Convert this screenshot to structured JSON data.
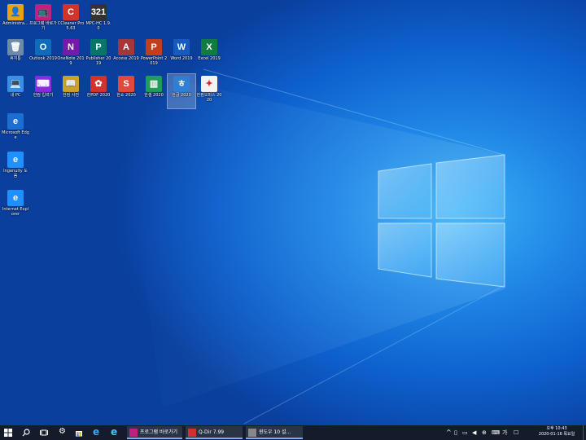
{
  "desktop": {
    "icons": [
      {
        "label": "Administra...",
        "col": 0,
        "row": 0,
        "color": "#e8a21a",
        "glyph": "👤",
        "icon": "user-folder-icon"
      },
      {
        "label": "프로그램 바로가기",
        "col": 1,
        "row": 0,
        "color": "#c2207e",
        "glyph": "📺",
        "icon": "tv-icon"
      },
      {
        "label": "CCleaner Pro 5.63",
        "col": 2,
        "row": 0,
        "color": "#d0352b",
        "glyph": "C",
        "icon": "ccleaner-icon"
      },
      {
        "label": "MPC-HC 1.9.0",
        "col": 3,
        "row": 0,
        "color": "#333333",
        "glyph": "321",
        "icon": "mpc-icon"
      },
      {
        "label": "휴지통",
        "col": 0,
        "row": 1,
        "color": "#6d8aa6",
        "glyph": "🗑",
        "icon": "recycle-bin-icon"
      },
      {
        "label": "Outlook 2019",
        "col": 1,
        "row": 1,
        "color": "#0f6cbd",
        "glyph": "O",
        "icon": "outlook-icon"
      },
      {
        "label": "OneNote 2019",
        "col": 2,
        "row": 1,
        "color": "#7719aa",
        "glyph": "N",
        "icon": "onenote-icon"
      },
      {
        "label": "Publisher 2019",
        "col": 3,
        "row": 1,
        "color": "#077568",
        "glyph": "P",
        "icon": "publisher-icon"
      },
      {
        "label": "Access 2019",
        "col": 4,
        "row": 1,
        "color": "#a4373a",
        "glyph": "A",
        "icon": "access-icon"
      },
      {
        "label": "PowerPoint 2019",
        "col": 5,
        "row": 1,
        "color": "#c43e1c",
        "glyph": "P",
        "icon": "powerpoint-icon"
      },
      {
        "label": "Word 2019",
        "col": 6,
        "row": 1,
        "color": "#185abd",
        "glyph": "W",
        "icon": "word-icon"
      },
      {
        "label": "Excel 2019",
        "col": 7,
        "row": 1,
        "color": "#107c41",
        "glyph": "X",
        "icon": "excel-icon"
      },
      {
        "label": "내 PC",
        "col": 0,
        "row": 2,
        "color": "#3a8ee6",
        "glyph": "💻",
        "icon": "this-pc-icon"
      },
      {
        "label": "한컴 입력기",
        "col": 1,
        "row": 2,
        "color": "#8a2be2",
        "glyph": "⌨",
        "icon": "hancom-input-icon"
      },
      {
        "label": "한컴 사전",
        "col": 2,
        "row": 2,
        "color": "#c9a227",
        "glyph": "📖",
        "icon": "hancom-dictionary-icon"
      },
      {
        "label": "한PDF 2020",
        "col": 3,
        "row": 2,
        "color": "#d0342c",
        "glyph": "✿",
        "icon": "hanpdf-icon"
      },
      {
        "label": "한쇼 2020",
        "col": 4,
        "row": 2,
        "color": "#e2483d",
        "glyph": "S",
        "icon": "hanshow-icon"
      },
      {
        "label": "한셀 2020",
        "col": 5,
        "row": 2,
        "color": "#1f9e55",
        "glyph": "▥",
        "icon": "hancell-icon"
      },
      {
        "label": "한글 2020",
        "col": 6,
        "row": 2,
        "color": "#2f7fd6",
        "glyph": "ㅎ",
        "icon": "hangul-icon",
        "selected": true
      },
      {
        "label": "한컴오피스 2020",
        "col": 7,
        "row": 2,
        "color": "#f2f2f2",
        "glyph": "✦",
        "icon": "hancom-office-icon"
      },
      {
        "label": "Microsoft Edge",
        "col": 0,
        "row": 3,
        "color": "#1c6fd1",
        "glyph": "e",
        "icon": "edge-icon"
      },
      {
        "label": "Ingenuity 도움",
        "col": 0,
        "row": 4,
        "color": "#1e90ff",
        "glyph": "e",
        "icon": "ie-icon"
      },
      {
        "label": "Internet Explorer",
        "col": 0,
        "row": 5,
        "color": "#1e90ff",
        "glyph": "e",
        "icon": "internet-explorer-icon"
      }
    ]
  },
  "taskbar": {
    "apps": [
      {
        "label": "프로그램 바로가기",
        "color": "#c2207e",
        "icon": "tv-icon"
      },
      {
        "label": "Q-Dir 7.99",
        "color": "#d03030",
        "icon": "qdir-icon"
      },
      {
        "label": "윈도우 10 설...",
        "color": "#888888",
        "icon": "window-icon"
      }
    ],
    "ime": "가",
    "clock": {
      "time": "오후 10:43",
      "date": "2020-01-16 목요일"
    }
  }
}
